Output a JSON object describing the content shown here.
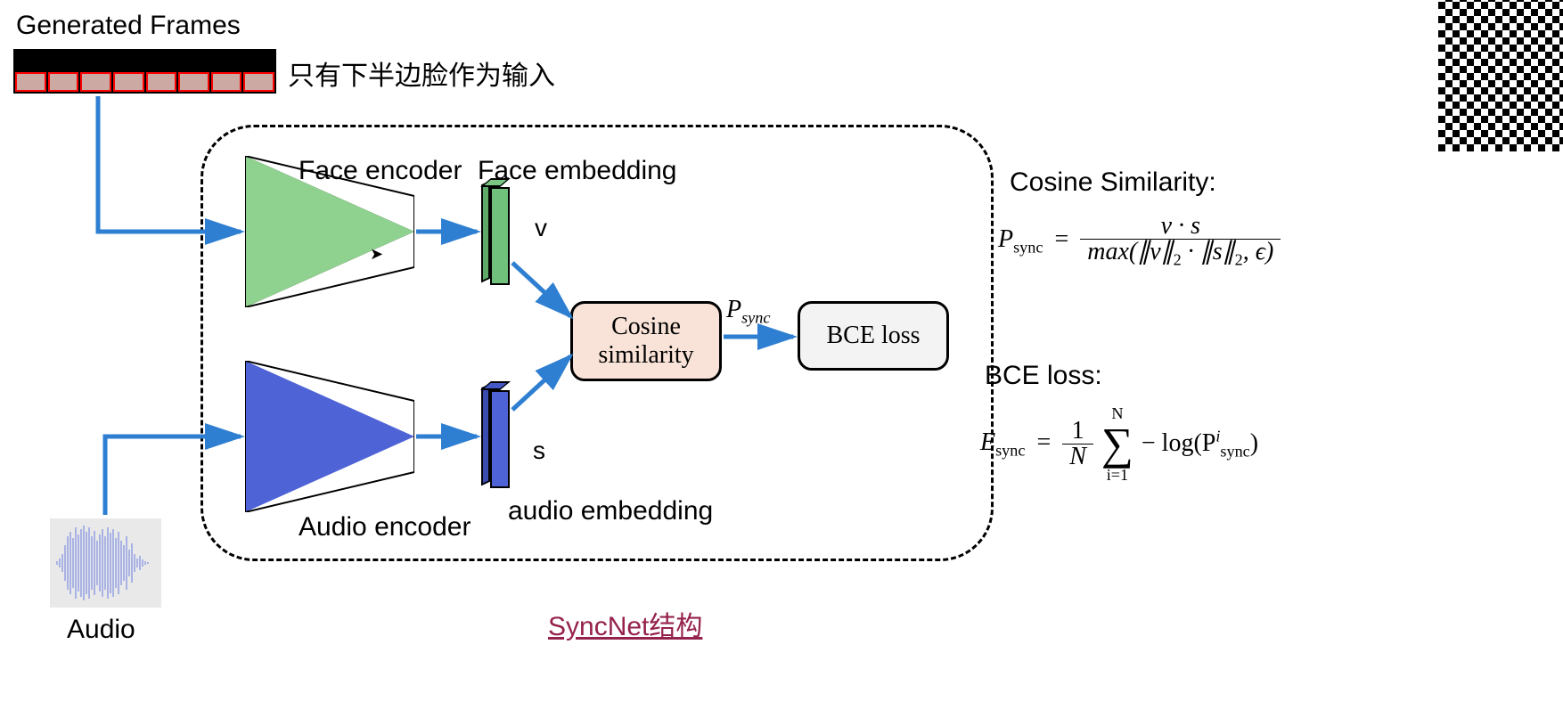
{
  "labels": {
    "generated_frames": "Generated Frames",
    "input_note": "只有下半边脸作为输入",
    "face_encoder": "Face encoder",
    "face_embedding": "Face embedding",
    "audio_encoder": "Audio encoder",
    "audio_embedding": "audio embedding",
    "audio": "Audio",
    "v": "v",
    "s": "s",
    "cosine_similarity_box": "Cosine\nsimilarity",
    "bce_loss_box": "BCE loss",
    "p_sync": "P",
    "caption": "SyncNet结构"
  },
  "equations": {
    "cos_title": "Cosine Similarity:",
    "bce_title": "BCE loss:",
    "p_sync_lhs": "P",
    "p_sync_sub": "sync",
    "cos_numerator": "v · s",
    "cos_den_left": "max(∥v∥",
    "cos_den_mid": " · ∥s∥",
    "cos_den_right": ", ϵ)",
    "two": "2",
    "e_sync": "E",
    "frac_1n_num": "1",
    "frac_1n_den": "N",
    "sum_top": "N",
    "sum_bottom": "i=1",
    "neg_log": "− log(P",
    "close_paren": ")",
    "sup_i": "i"
  },
  "frames_count": 8
}
